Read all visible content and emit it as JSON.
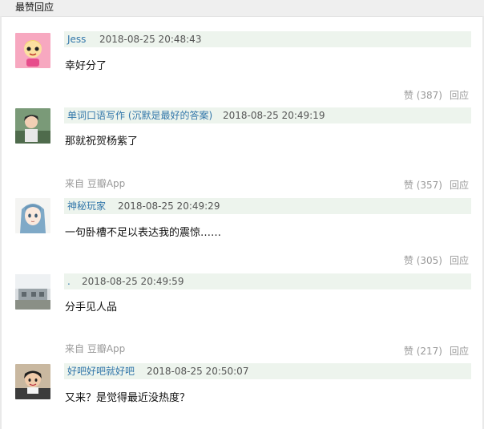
{
  "section": {
    "title": "最赞回应"
  },
  "comments": [
    {
      "username": "Jess",
      "time": "2018-08-25 20:48:43",
      "text": "幸好分了",
      "source": "",
      "like_label": "赞 (387)",
      "reply_label": "回应"
    },
    {
      "username": "单词口语写作 (沉默是最好的答案)",
      "time": "2018-08-25 20:49:19",
      "text": "那就祝贺杨紫了",
      "source": "来自 豆瓣App",
      "like_label": "赞 (357)",
      "reply_label": "回应"
    },
    {
      "username": "神秘玩家",
      "time": "2018-08-25 20:49:29",
      "text": "一句卧槽不足以表达我的震惊……",
      "source": "",
      "like_label": "赞 (305)",
      "reply_label": "回应"
    },
    {
      "username": ".",
      "time": "2018-08-25 20:49:59",
      "text": "分手见人品",
      "source": "来自 豆瓣App",
      "like_label": "赞 (217)",
      "reply_label": "回应"
    },
    {
      "username": "好吧好吧就好吧",
      "time": "2018-08-25 20:50:07",
      "text": "又来？是觉得最近没热度？",
      "source": "",
      "like_label": "",
      "reply_label": ""
    }
  ]
}
